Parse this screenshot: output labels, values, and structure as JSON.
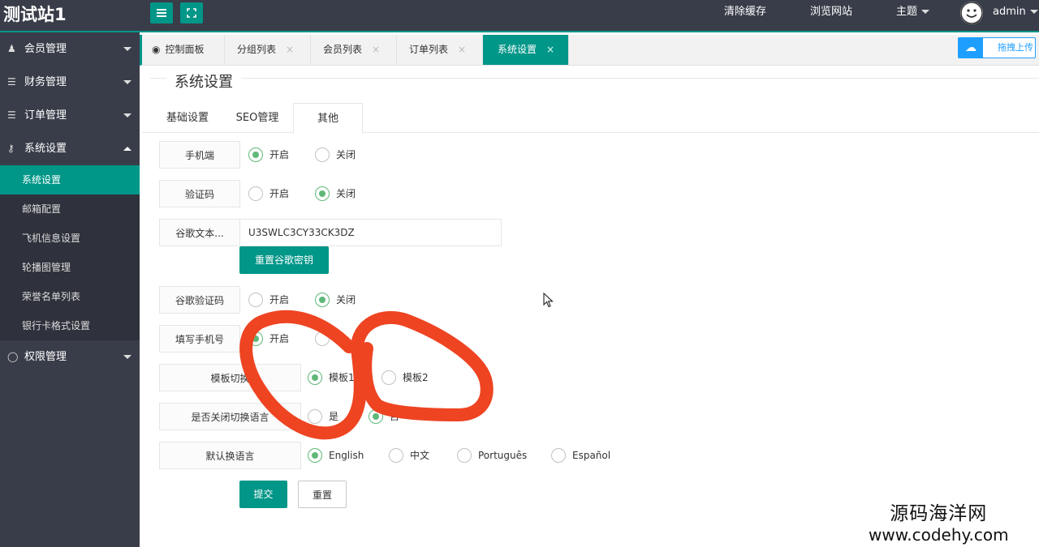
{
  "header": {
    "logo": "测试站1",
    "clear_cache": "清除缓存",
    "browse_site": "浏览网站",
    "theme": "主题",
    "user": "admin"
  },
  "sidebar": {
    "groups": [
      {
        "label": "会员管理",
        "icon": "user-icon"
      },
      {
        "label": "财务管理",
        "icon": "database-icon"
      },
      {
        "label": "订单管理",
        "icon": "database-icon"
      },
      {
        "label": "系统设置",
        "icon": "key-icon"
      },
      {
        "label": "权限管理",
        "icon": "globe-icon"
      }
    ],
    "subitems": [
      "系统设置",
      "邮箱配置",
      "飞机信息设置",
      "轮播图管理",
      "荣誉名单列表",
      "银行卡格式设置"
    ],
    "active_subitem": "系统设置"
  },
  "tabs": [
    {
      "label": "控制面板"
    },
    {
      "label": "分组列表"
    },
    {
      "label": "会员列表"
    },
    {
      "label": "订单列表"
    },
    {
      "label": "系统设置"
    }
  ],
  "tab_close": "×",
  "upload": {
    "label": "拖拽上传"
  },
  "page": {
    "title": "系统设置",
    "subtabs": [
      "基础设置",
      "SEO管理",
      "其他"
    ],
    "active_subtab": "其他"
  },
  "form": {
    "mobile": {
      "label": "手机端",
      "options": [
        "开启",
        "关闭"
      ],
      "selected": "开启"
    },
    "captcha": {
      "label": "验证码",
      "options": [
        "开启",
        "关闭"
      ],
      "selected": "关闭"
    },
    "google_text": {
      "label": "谷歌文本...",
      "value": "U3SWLC3CY33CK3DZ",
      "reset_button": "重置谷歌密钥"
    },
    "google_captcha": {
      "label": "谷歌验证码",
      "options": [
        "开启",
        "关闭"
      ],
      "selected": "关闭"
    },
    "fill_phone": {
      "label": "填写手机号",
      "options": [
        "开启"
      ],
      "selected": "开启"
    },
    "template": {
      "label": "模板切换",
      "options": [
        "模板1",
        "模板2"
      ],
      "selected": "模板1"
    },
    "close_lang": {
      "label": "是否关闭切换语言",
      "options": [
        "是",
        "否"
      ],
      "selected": "否"
    },
    "default_lang": {
      "label": "默认换语言",
      "options": [
        "English",
        "中文",
        "Português",
        "Español"
      ],
      "selected": "English"
    },
    "submit": "提交",
    "reset": "重置"
  },
  "watermark": {
    "line1": "源码海洋网",
    "line2": "www.codehy.com"
  },
  "colors": {
    "accent": "#009688",
    "sidebar": "#393d49",
    "radio_on": "#5fb878",
    "scribble": "#ee4422"
  }
}
